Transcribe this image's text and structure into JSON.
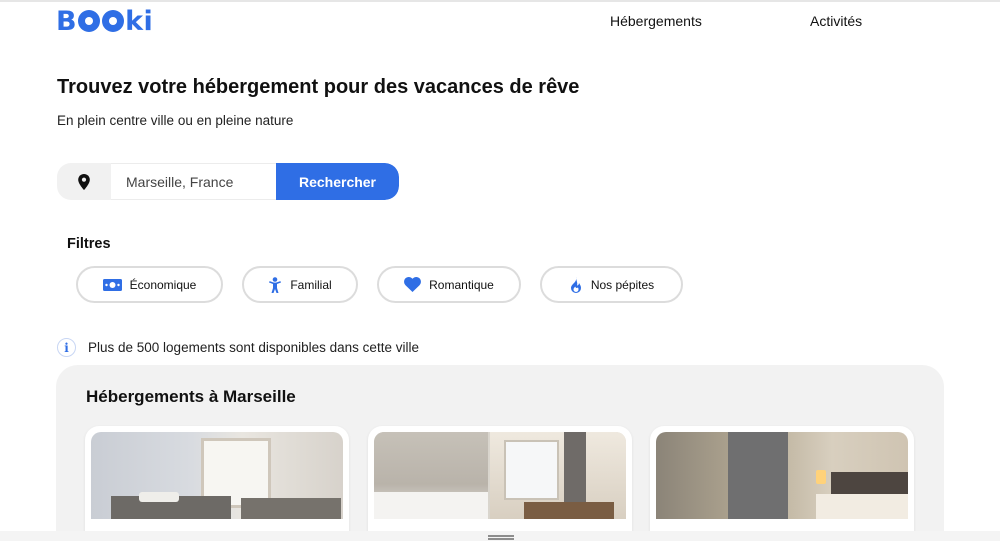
{
  "header": {
    "logo": "Booki",
    "nav": [
      "Hébergements",
      "Activités"
    ]
  },
  "hero": {
    "title": "Trouvez votre hébergement pour des vacances de rêve",
    "subtitle": "En plein centre ville ou en pleine nature"
  },
  "search": {
    "icon": "location-pin-icon",
    "value": "Marseille, France",
    "button": "Rechercher"
  },
  "filters": {
    "label": "Filtres",
    "chips": [
      {
        "label": "Économique",
        "icon": "money-icon"
      },
      {
        "label": "Familial",
        "icon": "child-icon"
      },
      {
        "label": "Romantique",
        "icon": "heart-icon"
      },
      {
        "label": "Nos pépites",
        "icon": "fire-icon"
      }
    ]
  },
  "info": {
    "icon": "info-icon",
    "text": "Plus de 500 logements sont disponibles dans cette ville"
  },
  "listings": {
    "title": "Hébergements à Marseille"
  },
  "colors": {
    "accent": "#2f6ee5",
    "panel": "#f2f2f2"
  }
}
